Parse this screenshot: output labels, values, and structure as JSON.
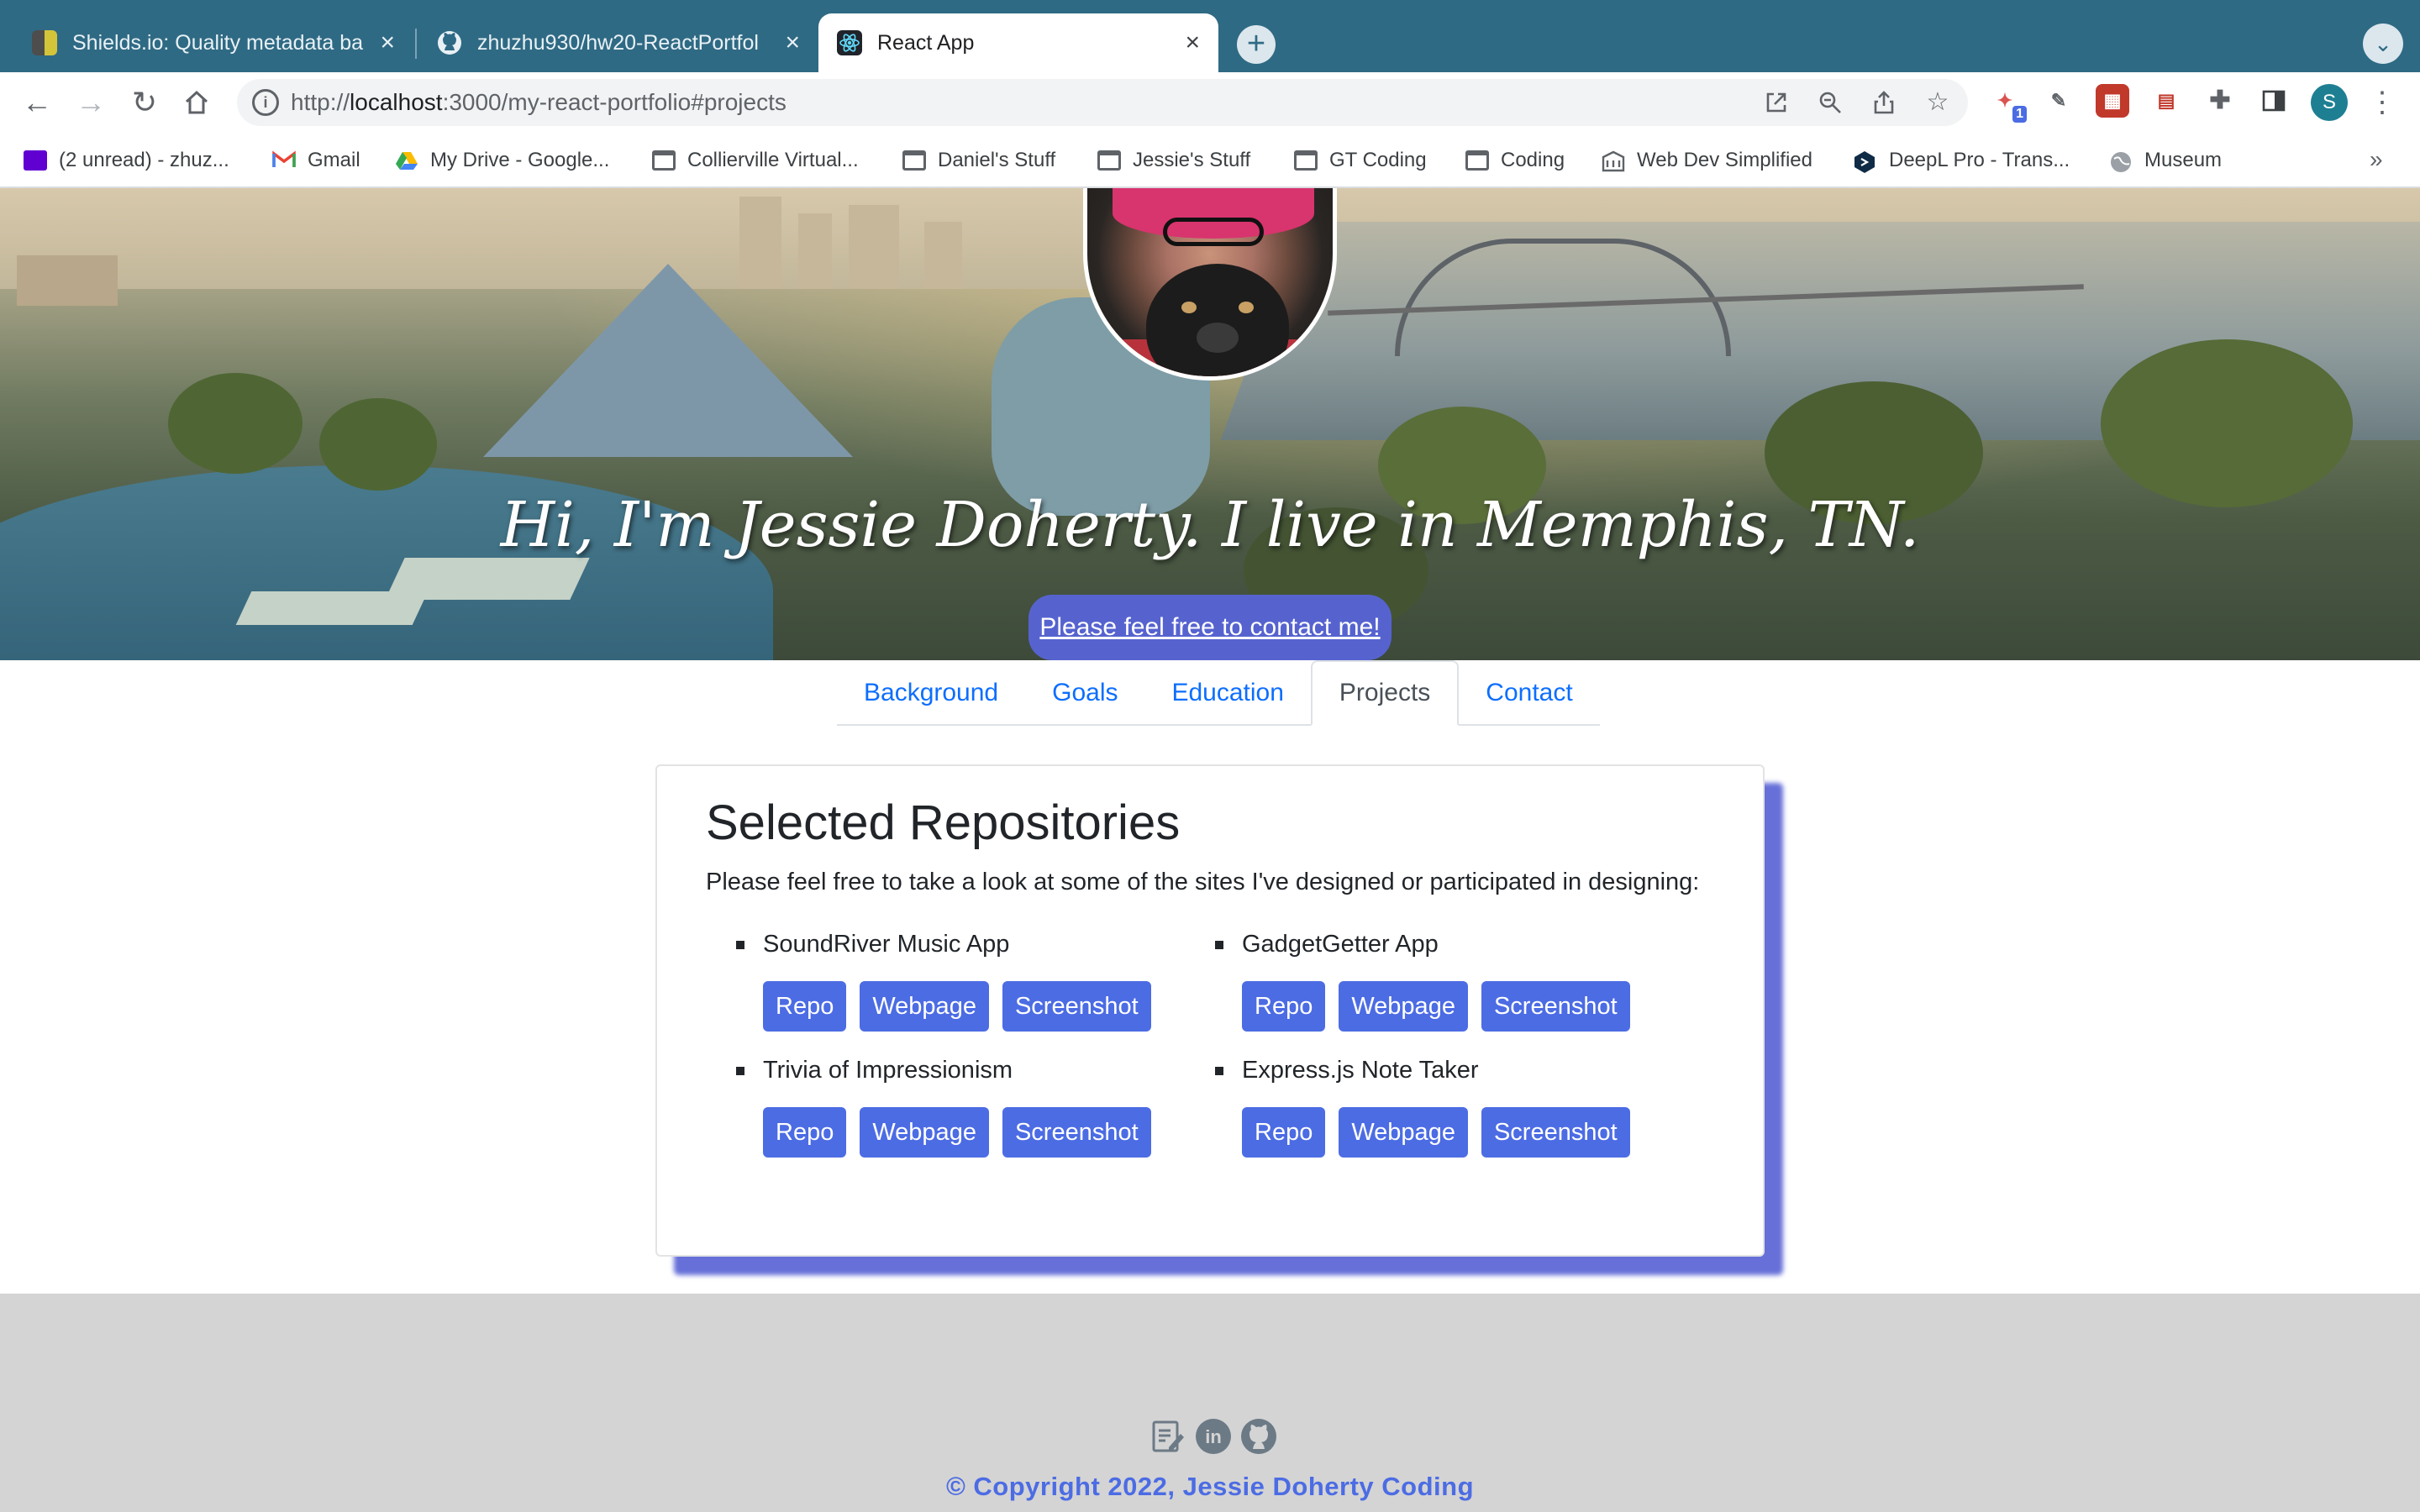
{
  "browser": {
    "tabs": [
      {
        "title": "Shields.io: Quality metadata ba",
        "favicon": "shields-icon"
      },
      {
        "title": "zhuzhu930/hw20-ReactPortfol",
        "favicon": "github-icon"
      },
      {
        "title": "React App",
        "favicon": "react-icon",
        "active": true
      }
    ],
    "url_prefix": "http://",
    "url_host": "localhost",
    "url_rest": ":3000/my-react-portfolio#projects",
    "profile_initial": "S",
    "extension_badge": "1",
    "bookmarks": [
      {
        "label": "(2 unread) - zhuz...",
        "icon": "yahoo-mail-icon"
      },
      {
        "label": "Gmail",
        "icon": "gmail-icon"
      },
      {
        "label": "My Drive - Google...",
        "icon": "google-drive-icon"
      },
      {
        "label": "Collierville Virtual...",
        "icon": "folder-icon"
      },
      {
        "label": "Daniel's Stuff",
        "icon": "folder-icon"
      },
      {
        "label": "Jessie's Stuff",
        "icon": "folder-icon"
      },
      {
        "label": "GT Coding",
        "icon": "folder-icon"
      },
      {
        "label": "Coding",
        "icon": "folder-icon"
      },
      {
        "label": "Web Dev Simplified",
        "icon": "building-icon"
      },
      {
        "label": "DeepL Pro - Trans...",
        "icon": "deepl-icon"
      },
      {
        "label": "Museum",
        "icon": "globe-icon"
      }
    ],
    "bookmarks_more": "»"
  },
  "hero": {
    "title": "Hi, I'm Jessie Doherty. I live in Memphis, TN.",
    "cta": "Please feel free to contact me!"
  },
  "nav": {
    "tabs": [
      "Background",
      "Goals",
      "Education",
      "Projects",
      "Contact"
    ],
    "active": "Projects"
  },
  "projects": {
    "title": "Selected Repositories",
    "intro": "Please feel free to take a look at some of the sites I've designed or participated in designing:",
    "items": [
      {
        "name": "SoundRiver Music App",
        "buttons": [
          "Repo",
          "Webpage",
          "Screenshot"
        ]
      },
      {
        "name": "GadgetGetter App",
        "buttons": [
          "Repo",
          "Webpage",
          "Screenshot"
        ]
      },
      {
        "name": "Trivia of Impressionism",
        "buttons": [
          "Repo",
          "Webpage",
          "Screenshot"
        ]
      },
      {
        "name": "Express.js Note Taker",
        "buttons": [
          "Repo",
          "Webpage",
          "Screenshot"
        ]
      }
    ]
  },
  "footer": {
    "icons": [
      "resume-icon",
      "linkedin-icon",
      "github-icon"
    ],
    "copyright": "© Copyright 2022, Jessie Doherty Coding"
  },
  "colors": {
    "chrome_tabstrip": "#2f6a84",
    "link_blue": "#0d6efd",
    "button_blue": "#4c6ce4",
    "card_shadow": "#6670d8",
    "footer_bg": "#d4d4d4"
  }
}
